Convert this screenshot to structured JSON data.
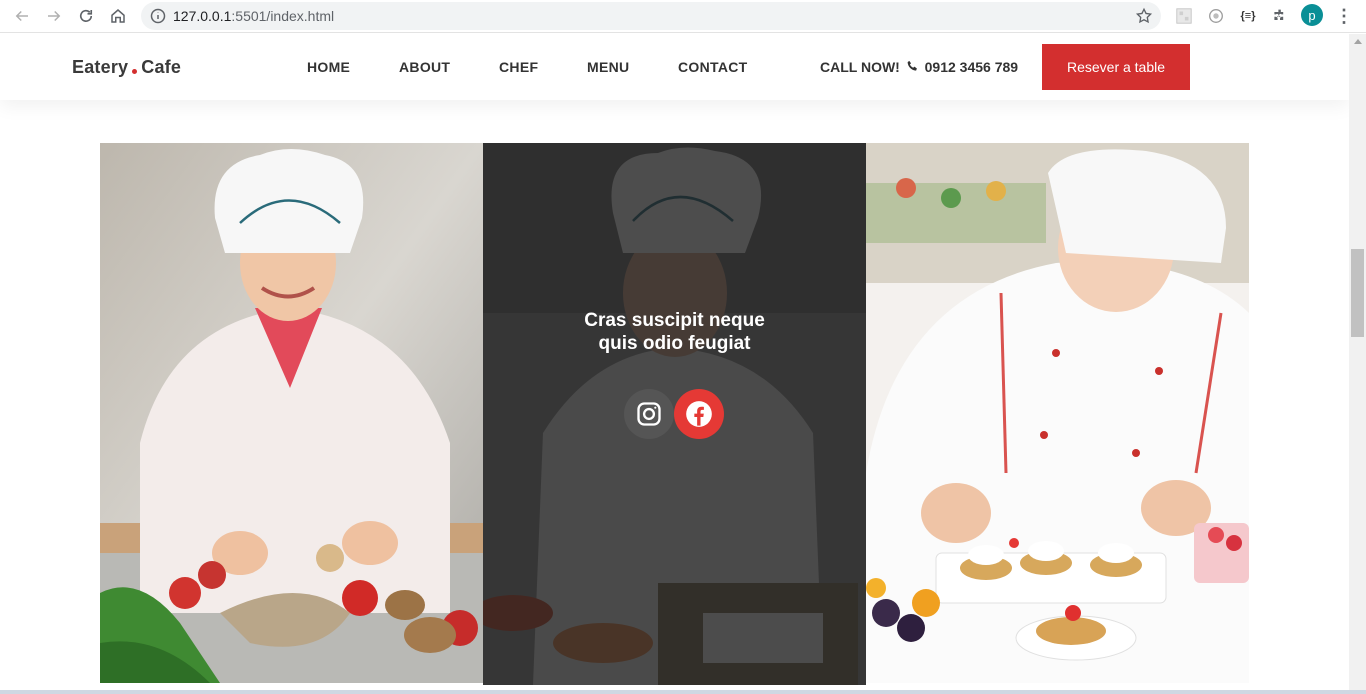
{
  "browser": {
    "url_host": "127.0.0.1",
    "url_rest": ":5501/index.html",
    "profile_initial": "p"
  },
  "site": {
    "logo_left": "Eatery",
    "logo_right": "Cafe",
    "nav": [
      "HOME",
      "ABOUT",
      "CHEF",
      "MENU",
      "CONTACT"
    ],
    "call_label": "CALL NOW!",
    "call_number": "0912 3456 789",
    "reserve_label": "Resever a table"
  },
  "chef_hover": {
    "title_line1": "Cras suscipit neque",
    "title_line2": "quis odio feugiat"
  },
  "colors": {
    "accent": "#d32f2f",
    "facebook_button": "#e53935",
    "instagram_button": "#555555"
  },
  "icons": [
    "back-icon",
    "forward-icon",
    "reload-icon",
    "home-icon",
    "info-icon",
    "star-icon",
    "extension-icon",
    "phone-icon",
    "instagram-icon",
    "facebook-icon"
  ]
}
